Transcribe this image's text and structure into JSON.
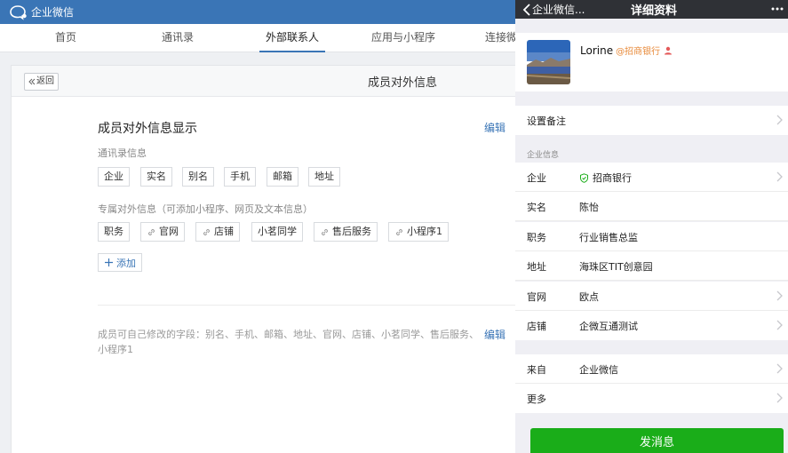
{
  "app": {
    "logo_text": "企业微信"
  },
  "nav": {
    "tabs": [
      {
        "label": "首页"
      },
      {
        "label": "通讯录"
      },
      {
        "label": "外部联系人"
      },
      {
        "label": "应用与小程序"
      },
      {
        "label": "连接微"
      }
    ],
    "active_tab": 2
  },
  "panel": {
    "back_label": "返回",
    "title": "成员对外信息",
    "section_title": "成员对外信息显示",
    "edit_label": "编辑",
    "contact_info_label": "通讯录信息",
    "contact_fields": [
      "企业",
      "实名",
      "别名",
      "手机",
      "邮箱",
      "地址"
    ],
    "exclusive_label": "专属对外信息（可添加小程序、网页及文本信息）",
    "exclusive_fields": [
      {
        "label": "职务",
        "icon": ""
      },
      {
        "label": "官网",
        "icon": "link-icon"
      },
      {
        "label": "店铺",
        "icon": "link-icon"
      },
      {
        "label": "小茗同学",
        "icon": ""
      },
      {
        "label": "售后服务",
        "icon": "link-icon"
      },
      {
        "label": "小程序1",
        "icon": "link-icon"
      }
    ],
    "add_label": "添加",
    "note": "成员可自己修改的字段：别名、手机、邮箱、地址、官网、店铺、小茗同学、售后服务、小程序1",
    "edit_label_2": "编辑"
  },
  "mobile": {
    "back_label": "企业微信...",
    "title": "详细资料",
    "profile": {
      "name": "Lorine",
      "company_tag": "@招商银行"
    },
    "remark_label": "设置备注",
    "company_group_label": "企业信息",
    "rows": [
      {
        "label": "企业",
        "value": "招商银行"
      },
      {
        "label": "实名",
        "value": "陈怡"
      },
      {
        "label": "职务",
        "value": "行业销售总监"
      },
      {
        "label": "地址",
        "value": "海珠区TIT创意园"
      },
      {
        "label": "官网",
        "value": "欧点"
      },
      {
        "label": "店铺",
        "value": "企微互通测试"
      }
    ],
    "from_row": {
      "label": "来自",
      "value": "企业微信"
    },
    "more_label": "更多",
    "send_label": "发消息"
  },
  "colors": {
    "brand_blue": "#3a75b6",
    "wechat_green": "#1aad19",
    "company_tag": "#e88a3a",
    "mobile_header": "#2f3136"
  }
}
